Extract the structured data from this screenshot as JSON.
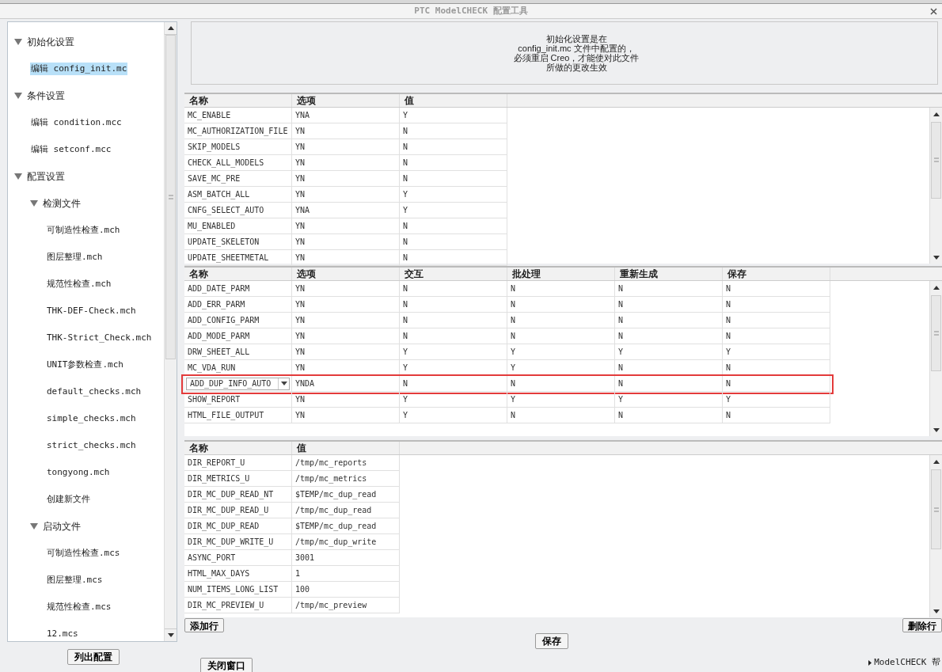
{
  "window": {
    "title": "PTC ModelCHECK 配置工具"
  },
  "tree": {
    "items": [
      {
        "label": "初始化设置",
        "expanded": true,
        "children": [
          {
            "label": "编辑 config_init.mc",
            "selected": true
          }
        ]
      },
      {
        "label": "条件设置",
        "expanded": true,
        "children": [
          {
            "label": "编辑 condition.mcc",
            "selected": false
          },
          {
            "label": "编辑 setconf.mcc",
            "selected": false
          }
        ]
      },
      {
        "label": "配置设置",
        "expanded": true,
        "children": [
          {
            "label": "检测文件",
            "expanded": true,
            "children": [
              {
                "label": "可制造性检查.mch",
                "selected": false
              },
              {
                "label": "图层整理.mch",
                "selected": false
              },
              {
                "label": "规范性检查.mch",
                "selected": false
              },
              {
                "label": "THK-DEF-Check.mch",
                "selected": false
              },
              {
                "label": "THK-Strict_Check.mch",
                "selected": false
              },
              {
                "label": "UNIT参数检查.mch",
                "selected": false
              },
              {
                "label": "default_checks.mch",
                "selected": false
              },
              {
                "label": "simple_checks.mch",
                "selected": false
              },
              {
                "label": "strict_checks.mch",
                "selected": false
              },
              {
                "label": "tongyong.mch",
                "selected": false
              },
              {
                "label": "创建新文件",
                "selected": false
              }
            ]
          },
          {
            "label": "启动文件",
            "expanded": true,
            "children": [
              {
                "label": "可制造性检查.mcs",
                "selected": false
              },
              {
                "label": "图层整理.mcs",
                "selected": false
              },
              {
                "label": "规范性检查.mcs",
                "selected": false
              },
              {
                "label": "12.mcs",
                "selected": false
              }
            ]
          }
        ]
      }
    ]
  },
  "list_button": "列出配置",
  "info": [
    "初始化设置是在",
    "config_init.mc 文件中配置的，",
    "必须重启 Creo，才能使对此文件",
    "所做的更改生效"
  ],
  "table1": {
    "columns": [
      "名称",
      "选项",
      "值"
    ],
    "rows": [
      [
        "MC_ENABLE",
        "YNA",
        "Y"
      ],
      [
        "MC_AUTHORIZATION_FILE",
        "YN",
        "N"
      ],
      [
        "SKIP_MODELS",
        "YN",
        "N"
      ],
      [
        "CHECK_ALL_MODELS",
        "YN",
        "N"
      ],
      [
        "SAVE_MC_PRE",
        "YN",
        "N"
      ],
      [
        "ASM_BATCH_ALL",
        "YN",
        "Y"
      ],
      [
        "CNFG_SELECT_AUTO",
        "YNA",
        "Y"
      ],
      [
        "MU_ENABLED",
        "YN",
        "N"
      ],
      [
        "UPDATE_SKELETON",
        "YN",
        "N"
      ],
      [
        "UPDATE_SHEETMETAL",
        "YN",
        "N"
      ]
    ]
  },
  "table2": {
    "columns": [
      "名称",
      "选项",
      "交互",
      "批处理",
      "重新生成",
      "保存"
    ],
    "rows": [
      {
        "cells": [
          "ADD_DATE_PARM",
          "YN",
          "N",
          "N",
          "N",
          "N"
        ],
        "highlighted": false,
        "editing": false
      },
      {
        "cells": [
          "ADD_ERR_PARM",
          "YN",
          "N",
          "N",
          "N",
          "N"
        ],
        "highlighted": false,
        "editing": false
      },
      {
        "cells": [
          "ADD_CONFIG_PARM",
          "YN",
          "N",
          "N",
          "N",
          "N"
        ],
        "highlighted": false,
        "editing": false
      },
      {
        "cells": [
          "ADD_MODE_PARM",
          "YN",
          "N",
          "N",
          "N",
          "N"
        ],
        "highlighted": false,
        "editing": false
      },
      {
        "cells": [
          "DRW_SHEET_ALL",
          "YN",
          "Y",
          "Y",
          "Y",
          "Y"
        ],
        "highlighted": false,
        "editing": false
      },
      {
        "cells": [
          "MC_VDA_RUN",
          "YN",
          "Y",
          "Y",
          "N",
          "N"
        ],
        "highlighted": false,
        "editing": false
      },
      {
        "cells": [
          "ADD_DUP_INFO_AUTO",
          "YNDA",
          "N",
          "N",
          "N",
          "N"
        ],
        "highlighted": true,
        "editing": true
      },
      {
        "cells": [
          "SHOW_REPORT",
          "YN",
          "Y",
          "Y",
          "Y",
          "Y"
        ],
        "highlighted": false,
        "editing": false
      },
      {
        "cells": [
          "HTML_FILE_OUTPUT",
          "YN",
          "Y",
          "N",
          "N",
          "N"
        ],
        "highlighted": false,
        "editing": false
      }
    ]
  },
  "table3": {
    "columns": [
      "名称",
      "值"
    ],
    "rows": [
      [
        "DIR_REPORT_U",
        "/tmp/mc_reports"
      ],
      [
        "DIR_METRICS_U",
        "/tmp/mc_metrics"
      ],
      [
        "DIR_MC_DUP_READ_NT",
        "$TEMP/mc_dup_read"
      ],
      [
        "DIR_MC_DUP_READ_U",
        "/tmp/mc_dup_read"
      ],
      [
        "DIR_MC_DUP_READ",
        "$TEMP/mc_dup_read"
      ],
      [
        "DIR_MC_DUP_WRITE_U",
        "/tmp/mc_dup_write"
      ],
      [
        "ASYNC_PORT",
        "3001"
      ],
      [
        "HTML_MAX_DAYS",
        "1"
      ],
      [
        "NUM_ITEMS_LONG_LIST",
        "100"
      ],
      [
        "DIR_MC_PREVIEW_U",
        "/tmp/mc_preview"
      ]
    ]
  },
  "buttons": {
    "add_row": "添加行",
    "delete_row": "删除行",
    "save": "保存",
    "close": "关闭窗口"
  },
  "help_link": "ModelCHECK 帮"
}
